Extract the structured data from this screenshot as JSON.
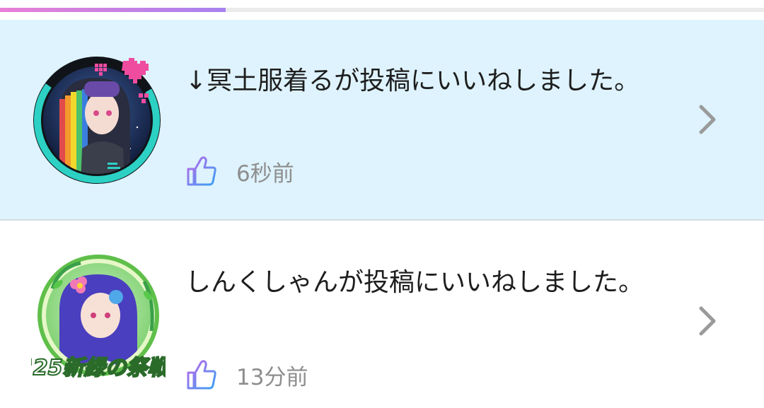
{
  "progress": {
    "fraction": 0.295
  },
  "notifications": [
    {
      "message": "↓冥土服着るが投稿にいいねしました。",
      "time": "6秒前",
      "icon": "thumbs-up-icon",
      "highlighted": true,
      "avatar": "avatar-with-cyan-frame-hearts"
    },
    {
      "message": "しんくしゃんが投稿にいいねしました。",
      "time": "13分前",
      "icon": "thumbs-up-icon",
      "highlighted": false,
      "avatar": "avatar-with-event-badge",
      "avatar_badge_text": "'25新緑の祭戦"
    }
  ],
  "colors": {
    "highlight_bg": "#def3fd",
    "progress_gradient_start": "#e97fd6",
    "progress_gradient_end": "#a782ef",
    "time_text": "#8e8e8e",
    "chevron": "#9a9a9a"
  }
}
